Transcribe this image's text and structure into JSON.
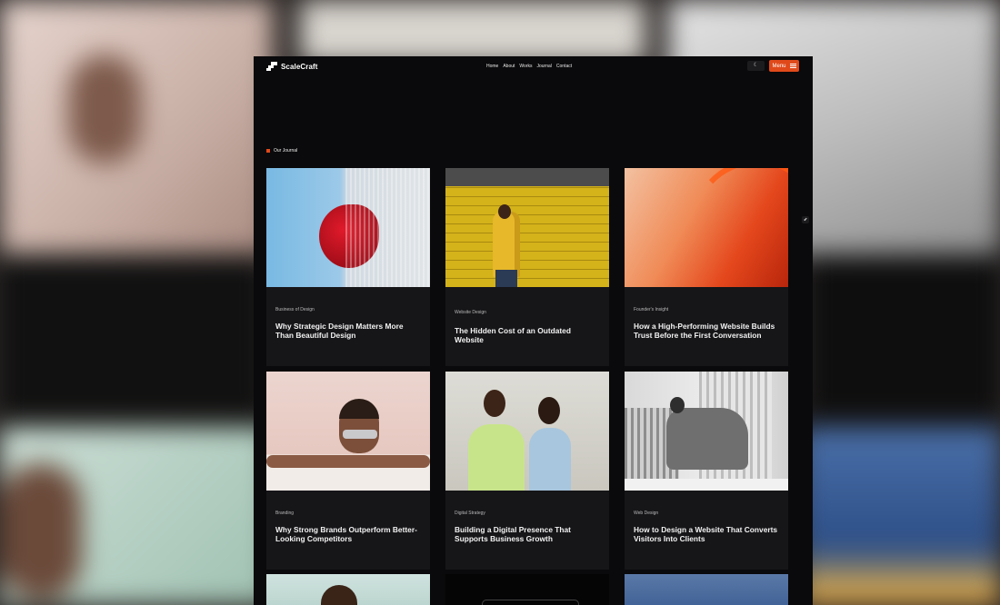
{
  "site": {
    "brand": "ScaleCraft",
    "nav": [
      "Home",
      "About",
      "Works",
      "Journal",
      "Contact"
    ],
    "theme_icon": "moon-icon",
    "menu_label": "Menu",
    "section_label": "Our Journal"
  },
  "posts": [
    {
      "category": "Business of Design",
      "title": "Why Strategic Design Matters More Than Beautiful Design"
    },
    {
      "category": "Website Design",
      "title": "The Hidden Cost of an Outdated Website"
    },
    {
      "category": "Founder's Insight",
      "title": "How a High-Performing Website Builds Trust Before the First Conversation"
    },
    {
      "category": "Branding",
      "title": "Why Strong Brands Outperform Better-Looking Competitors"
    },
    {
      "category": "Digital Strategy",
      "title": "Building a Digital Presence That Supports Business Growth"
    },
    {
      "category": "Web Design",
      "title": "How to Design a Website That Converts Visitors Into Clients"
    }
  ],
  "colors": {
    "accent": "#e0491a",
    "background": "#0a090b",
    "card": "#161518"
  }
}
